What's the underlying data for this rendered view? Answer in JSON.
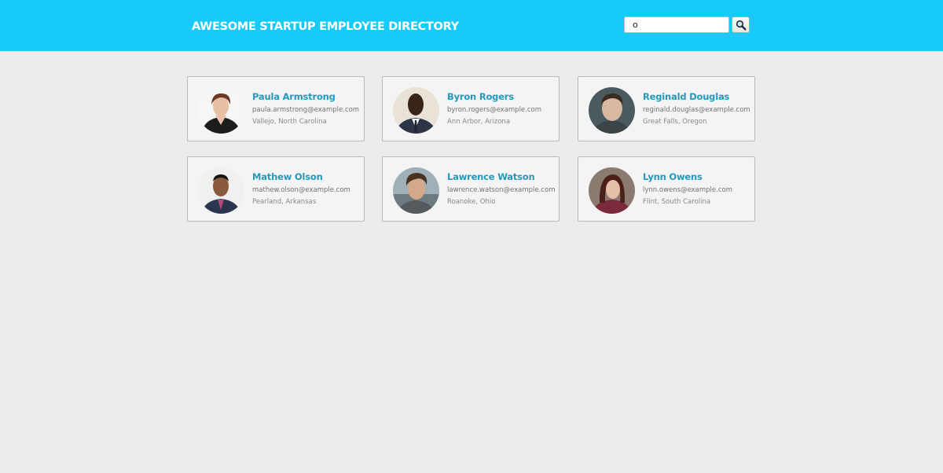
{
  "header": {
    "title": "AWESOME STARTUP EMPLOYEE DIRECTORY",
    "background_color": "#16cbf9"
  },
  "search": {
    "value": "o",
    "placeholder": "",
    "button_icon": "search-icon"
  },
  "employees": [
    {
      "name": "Paula Armstrong",
      "email": "paula.armstrong@example.com",
      "location": "Vallejo, North Carolina",
      "avatar_icon": "person-photo"
    },
    {
      "name": "Byron Rogers",
      "email": "byron.rogers@example.com",
      "location": "Ann Arbor, Arizona",
      "avatar_icon": "person-photo"
    },
    {
      "name": "Reginald Douglas",
      "email": "reginald.douglas@example.com",
      "location": "Great Falls, Oregon",
      "avatar_icon": "person-photo"
    },
    {
      "name": "Mathew Olson",
      "email": "mathew.olson@example.com",
      "location": "Pearland, Arkansas",
      "avatar_icon": "person-photo"
    },
    {
      "name": "Lawrence Watson",
      "email": "lawrence.watson@example.com",
      "location": "Roanoke, Ohio",
      "avatar_icon": "person-photo"
    },
    {
      "name": "Lynn Owens",
      "email": "lynn.owens@example.com",
      "location": "Flint, South Carolina",
      "avatar_icon": "person-photo"
    }
  ],
  "colors": {
    "accent": "#2498bd",
    "page_background": "#ececec",
    "card_background": "#f4f4f4"
  }
}
